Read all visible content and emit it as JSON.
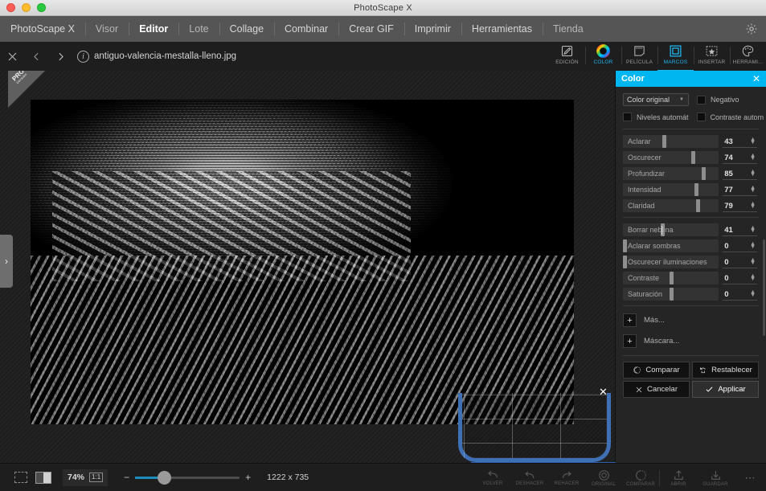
{
  "window": {
    "title": "PhotoScape X",
    "traffic_lights": [
      "close",
      "minimize",
      "zoom"
    ]
  },
  "menubar": {
    "items": [
      {
        "label": "PhotoScape X",
        "state": "normal"
      },
      {
        "label": "Visor",
        "state": "dim"
      },
      {
        "label": "Editor",
        "state": "active"
      },
      {
        "label": "Lote",
        "state": "dim"
      },
      {
        "label": "Collage",
        "state": "normal"
      },
      {
        "label": "Combinar",
        "state": "normal"
      },
      {
        "label": "Crear GIF",
        "state": "normal"
      },
      {
        "label": "Imprimir",
        "state": "normal"
      },
      {
        "label": "Herramientas",
        "state": "normal"
      },
      {
        "label": "Tienda",
        "state": "dim"
      }
    ],
    "settings_icon": "gear-icon"
  },
  "filebar": {
    "close_icon": "close-icon",
    "prev_icon": "chevron-left-icon",
    "next_icon": "chevron-right-icon",
    "info_icon": "info-icon",
    "filename": "antiguo-valencia-mestalla-lleno.jpg"
  },
  "modebar": {
    "items": [
      {
        "label": "EDICIÓN",
        "icon": "pencil-square-icon",
        "selected": false
      },
      {
        "label": "COLOR",
        "icon": "color-wheel-icon",
        "selected": false,
        "highlighted": true
      },
      {
        "label": "PELÍCULA",
        "icon": "film-note-icon",
        "selected": false
      },
      {
        "label": "MARCOS",
        "icon": "frame-square-icon",
        "selected": true
      },
      {
        "label": "INSERTAR",
        "icon": "star-dashed-icon",
        "selected": false
      },
      {
        "label": "HERRAMI...",
        "icon": "palette-icon",
        "selected": false
      }
    ]
  },
  "canvas": {
    "pro_badge": {
      "line1": "PRO",
      "line2": "Versión"
    },
    "left_handle_icon": "chevron-right-icon",
    "frame_overlay_close_icon": "close-icon"
  },
  "panel": {
    "title": "Color",
    "close_icon": "close-icon",
    "accent_color": "#00b6f0",
    "preset": {
      "value": "Color original",
      "caret_icon": "chevron-down-icon"
    },
    "checkboxes": [
      {
        "label": "Negativo",
        "checked": false
      },
      {
        "label": "Niveles automát",
        "checked": false
      },
      {
        "label": "Contraste autom",
        "checked": false
      }
    ],
    "sliders": [
      {
        "label": "Aclarar",
        "value": "43",
        "pos": 0.43
      },
      {
        "label": "Oscurecer",
        "value": "74",
        "pos": 0.74
      },
      {
        "label": "Profundizar",
        "value": "85",
        "pos": 0.85
      },
      {
        "label": "Intensidad",
        "value": "77",
        "pos": 0.77
      },
      {
        "label": "Claridad",
        "value": "79",
        "pos": 0.79
      },
      {
        "label": "Borrar neblina",
        "value": "41",
        "pos": 0.41,
        "caret": true
      },
      {
        "label": "Aclarar sombras",
        "value": "0",
        "pos": 0.0
      },
      {
        "label": "Oscurecer iluminaciones",
        "value": "0",
        "pos": 0.0
      },
      {
        "label": "Contraste",
        "value": "0",
        "pos": 0.5
      },
      {
        "label": "Saturación",
        "value": "0",
        "pos": 0.5
      }
    ],
    "expanders": [
      {
        "label": "Más...",
        "icon": "plus-icon"
      },
      {
        "label": "Máscara...",
        "icon": "plus-icon"
      }
    ],
    "buttons": [
      {
        "label": "Comparar",
        "icon": "compare-circle-icon",
        "primary": false
      },
      {
        "label": "Restablecer",
        "icon": "undo-hand-icon",
        "primary": false
      },
      {
        "label": "Cancelar",
        "icon": "close-icon",
        "primary": false
      },
      {
        "label": "Applicar",
        "icon": "check-icon",
        "primary": true
      }
    ]
  },
  "statusbar": {
    "select_icon": "marquee-select-icon",
    "compare_icon": "split-compare-icon",
    "zoom_value": "74%",
    "one_to_one": "1:1",
    "zoom_minus_icon": "minus-icon",
    "zoom_plus_icon": "plus-icon",
    "zoom_slider_pos": 0.28,
    "dimensions": "1222 x 735",
    "tools": [
      {
        "label": "VOLVER",
        "icon": "back-arrow-icon"
      },
      {
        "label": "DESHACER",
        "icon": "undo-icon"
      },
      {
        "label": "REHACER",
        "icon": "redo-icon"
      },
      {
        "label": "ORIGINAL",
        "icon": "original-circle-icon"
      },
      {
        "label": "COMPARAR",
        "icon": "compare-circle-icon"
      },
      {
        "label": "ABRIR",
        "icon": "upload-icon"
      },
      {
        "label": "GUARDAR",
        "icon": "download-icon"
      },
      {
        "label": "",
        "icon": "more-dots-icon"
      }
    ]
  }
}
